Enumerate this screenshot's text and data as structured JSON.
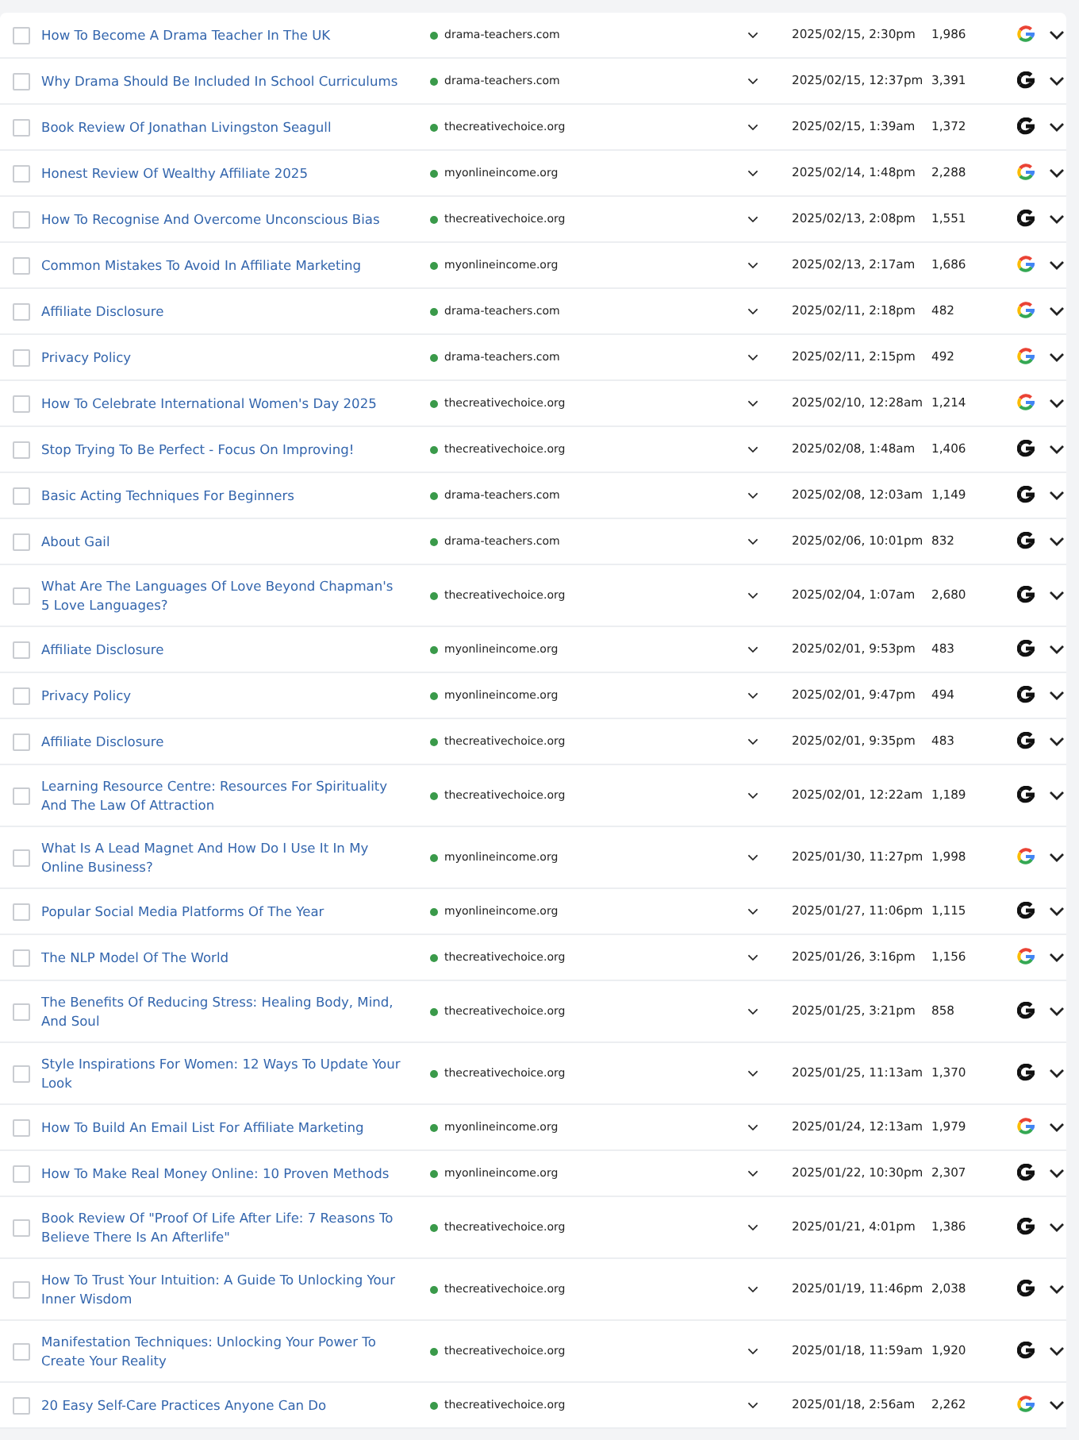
{
  "rows": [
    {
      "title": "How To Become A Drama Teacher In The UK",
      "checked": false,
      "site": "drama-teachers.com",
      "edited": "2025/02/15, 2:30pm",
      "words": "1,986",
      "google_colored": true
    },
    {
      "title": "Why Drama Should Be Included In School Curriculums",
      "checked": false,
      "site": "drama-teachers.com",
      "edited": "2025/02/15, 12:37pm",
      "words": "3,391",
      "google_colored": false
    },
    {
      "title": "Book Review Of Jonathan Livingston Seagull",
      "checked": false,
      "site": "thecreativechoice.org",
      "edited": "2025/02/15, 1:39am",
      "words": "1,372",
      "google_colored": false
    },
    {
      "title": "Honest Review Of Wealthy Affiliate 2025",
      "checked": false,
      "site": "myonlineincome.org",
      "edited": "2025/02/14, 1:48pm",
      "words": "2,288",
      "google_colored": true
    },
    {
      "title": "How To Recognise And Overcome Unconscious Bias",
      "checked": false,
      "site": "thecreativechoice.org",
      "edited": "2025/02/13, 2:08pm",
      "words": "1,551",
      "google_colored": false
    },
    {
      "title": "Common Mistakes To Avoid In Affiliate Marketing",
      "checked": false,
      "site": "myonlineincome.org",
      "edited": "2025/02/13, 2:17am",
      "words": "1,686",
      "google_colored": true
    },
    {
      "title": "Affiliate Disclosure",
      "checked": false,
      "site": "drama-teachers.com",
      "edited": "2025/02/11, 2:18pm",
      "words": "482",
      "google_colored": true
    },
    {
      "title": "Privacy Policy",
      "checked": false,
      "site": "drama-teachers.com",
      "edited": "2025/02/11, 2:15pm",
      "words": "492",
      "google_colored": true
    },
    {
      "title": "How To Celebrate International Women's Day 2025",
      "checked": false,
      "site": "thecreativechoice.org",
      "edited": "2025/02/10, 12:28am",
      "words": "1,214",
      "google_colored": true
    },
    {
      "title": "Stop Trying To Be Perfect - Focus On Improving!",
      "checked": false,
      "site": "thecreativechoice.org",
      "edited": "2025/02/08, 1:48am",
      "words": "1,406",
      "google_colored": false
    },
    {
      "title": "Basic Acting Techniques For Beginners",
      "checked": false,
      "site": "drama-teachers.com",
      "edited": "2025/02/08, 12:03am",
      "words": "1,149",
      "google_colored": false
    },
    {
      "title": "About Gail",
      "checked": false,
      "site": "drama-teachers.com",
      "edited": "2025/02/06, 10:01pm",
      "words": "832",
      "google_colored": false
    },
    {
      "title": "What Are The Languages Of Love Beyond Chapman's 5 Love Languages?",
      "checked": false,
      "site": "thecreativechoice.org",
      "edited": "2025/02/04, 1:07am",
      "words": "2,680",
      "google_colored": false
    },
    {
      "title": "Affiliate Disclosure",
      "checked": false,
      "site": "myonlineincome.org",
      "edited": "2025/02/01, 9:53pm",
      "words": "483",
      "google_colored": false
    },
    {
      "title": "Privacy Policy",
      "checked": false,
      "site": "myonlineincome.org",
      "edited": "2025/02/01, 9:47pm",
      "words": "494",
      "google_colored": false
    },
    {
      "title": "Affiliate Disclosure",
      "checked": false,
      "site": "thecreativechoice.org",
      "edited": "2025/02/01, 9:35pm",
      "words": "483",
      "google_colored": false
    },
    {
      "title": "Learning Resource Centre: Resources For Spirituality And The Law Of Attraction",
      "checked": false,
      "site": "thecreativechoice.org",
      "edited": "2025/02/01, 12:22am",
      "words": "1,189",
      "google_colored": false
    },
    {
      "title": "What Is A Lead Magnet And How Do I Use It In My Online Business?",
      "checked": false,
      "site": "myonlineincome.org",
      "edited": "2025/01/30, 11:27pm",
      "words": "1,998",
      "google_colored": true
    },
    {
      "title": "Popular Social Media Platforms Of The Year",
      "checked": false,
      "site": "myonlineincome.org",
      "edited": "2025/01/27, 11:06pm",
      "words": "1,115",
      "google_colored": false
    },
    {
      "title": "The NLP Model Of The World",
      "checked": false,
      "site": "thecreativechoice.org",
      "edited": "2025/01/26, 3:16pm",
      "words": "1,156",
      "google_colored": true
    },
    {
      "title": "The Benefits Of Reducing Stress: Healing Body, Mind, And Soul",
      "checked": false,
      "site": "thecreativechoice.org",
      "edited": "2025/01/25, 3:21pm",
      "words": "858",
      "google_colored": false
    },
    {
      "title": "Style Inspirations For Women: 12 Ways To Update Your Look",
      "checked": false,
      "site": "thecreativechoice.org",
      "edited": "2025/01/25, 11:13am",
      "words": "1,370",
      "google_colored": false
    },
    {
      "title": "How To Build An Email List For Affiliate Marketing",
      "checked": false,
      "site": "myonlineincome.org",
      "edited": "2025/01/24, 12:13am",
      "words": "1,979",
      "google_colored": true
    },
    {
      "title": "How To Make Real Money Online: 10 Proven Methods",
      "checked": false,
      "site": "myonlineincome.org",
      "edited": "2025/01/22, 10:30pm",
      "words": "2,307",
      "google_colored": false
    },
    {
      "title": "Book Review Of \"Proof Of Life After Life: 7 Reasons To Believe There Is An Afterlife\"",
      "checked": false,
      "site": "thecreativechoice.org",
      "edited": "2025/01/21, 4:01pm",
      "words": "1,386",
      "google_colored": false
    },
    {
      "title": "How To Trust Your Intuition: A Guide To Unlocking Your Inner Wisdom",
      "checked": false,
      "site": "thecreativechoice.org",
      "edited": "2025/01/19, 11:46pm",
      "words": "2,038",
      "google_colored": false
    },
    {
      "title": "Manifestation Techniques: Unlocking Your Power To Create Your Reality",
      "checked": false,
      "site": "thecreativechoice.org",
      "edited": "2025/01/18, 11:59am",
      "words": "1,920",
      "google_colored": false
    },
    {
      "title": "20 Easy Self-Care Practices Anyone Can Do",
      "checked": false,
      "site": "thecreativechoice.org",
      "edited": "2025/01/18, 2:56am",
      "words": "2,262",
      "google_colored": true
    }
  ]
}
